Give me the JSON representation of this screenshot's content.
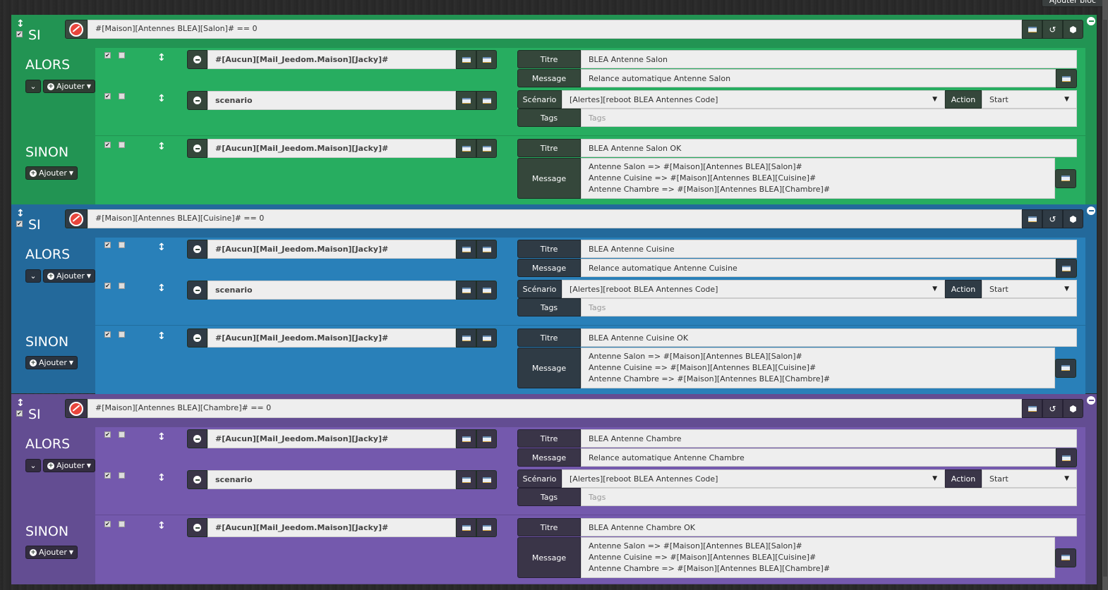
{
  "top_button": "Ajouter bloc",
  "labels": {
    "si": "SI",
    "alors": "ALORS",
    "sinon": "SINON",
    "ajouter": "Ajouter",
    "titre": "Titre",
    "message": "Message",
    "scenario": "Scénario",
    "action": "Action",
    "tags": "Tags"
  },
  "colors": {
    "green": "#229453",
    "blue": "#23699b",
    "purple": "#634d92"
  },
  "blocks": [
    {
      "condition": "#[Maison][Antennes BLEA][Salon]# == 0",
      "alors": {
        "mail_cmd": "#[Aucun][Mail_Jeedom.Maison][Jacky]#",
        "titre": "BLEA Antenne Salon",
        "message": "Relance automatique Antenne Salon",
        "scenario_cmd": "scenario",
        "scenario_value": "[Alertes][reboot BLEA Antennes Code]",
        "action_value": "Start",
        "tags_placeholder": "Tags"
      },
      "sinon": {
        "mail_cmd": "#[Aucun][Mail_Jeedom.Maison][Jacky]#",
        "titre": "BLEA Antenne Salon OK",
        "message_lines": [
          "Antenne Salon => #[Maison][Antennes BLEA][Salon]#",
          "Antenne Cuisine => #[Maison][Antennes BLEA][Cuisine]#",
          "Antenne Chambre => #[Maison][Antennes BLEA][Chambre]#"
        ]
      }
    },
    {
      "condition": "#[Maison][Antennes BLEA][Cuisine]# == 0",
      "alors": {
        "mail_cmd": "#[Aucun][Mail_Jeedom.Maison][Jacky]#",
        "titre": "BLEA Antenne Cuisine",
        "message": "Relance automatique Antenne Cuisine",
        "scenario_cmd": "scenario",
        "scenario_value": "[Alertes][reboot BLEA Antennes Code]",
        "action_value": "Start",
        "tags_placeholder": "Tags"
      },
      "sinon": {
        "mail_cmd": "#[Aucun][Mail_Jeedom.Maison][Jacky]#",
        "titre": "BLEA Antenne Cuisine OK",
        "message_lines": [
          "Antenne Salon => #[Maison][Antennes BLEA][Salon]#",
          "Antenne Cuisine => #[Maison][Antennes BLEA][Cuisine]#",
          "Antenne Chambre => #[Maison][Antennes BLEA][Chambre]#"
        ]
      }
    },
    {
      "condition": "#[Maison][Antennes BLEA][Chambre]# == 0",
      "alors": {
        "mail_cmd": "#[Aucun][Mail_Jeedom.Maison][Jacky]#",
        "titre": "BLEA Antenne Chambre",
        "message": "Relance automatique Antenne Chambre",
        "scenario_cmd": "scenario",
        "scenario_value": "[Alertes][reboot BLEA Antennes Code]",
        "action_value": "Start",
        "tags_placeholder": "Tags"
      },
      "sinon": {
        "mail_cmd": "#[Aucun][Mail_Jeedom.Maison][Jacky]#",
        "titre": "BLEA Antenne Chambre OK",
        "message_lines": [
          "Antenne Salon => #[Maison][Antennes BLEA][Salon]#",
          "Antenne Cuisine => #[Maison][Antennes BLEA][Cuisine]#",
          "Antenne Chambre => #[Maison][Antennes BLEA][Chambre]#"
        ]
      }
    }
  ]
}
